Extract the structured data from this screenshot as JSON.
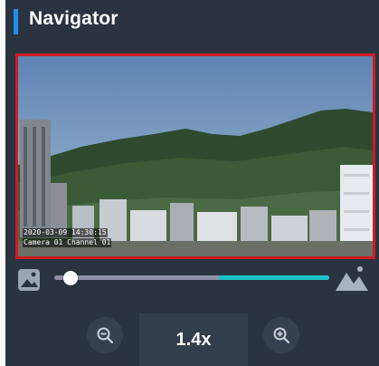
{
  "header": {
    "title": "Navigator",
    "accent_color": "#1e90e8"
  },
  "preview": {
    "frame_color": "#d11a24",
    "overlay_line1": "2020-03-09 14:30:15",
    "overlay_line2": "Camera 01 Channel 01"
  },
  "zoom_slider": {
    "min_icon": "small-image-icon",
    "max_icon": "large-image-icon",
    "value_fraction": 0.06,
    "fill_start_fraction": 0.6,
    "fill_color": "#18c0c7"
  },
  "zoom_controls": {
    "zoom_out_icon": "zoom-out-icon",
    "zoom_in_icon": "zoom-in-icon",
    "zoom_value": "1.4x"
  }
}
